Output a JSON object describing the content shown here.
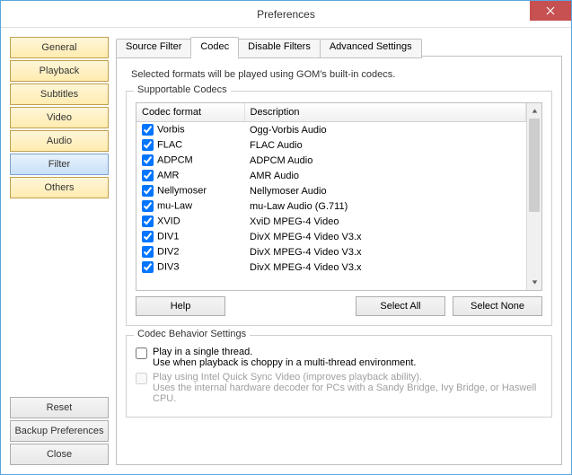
{
  "window": {
    "title": "Preferences"
  },
  "sidebar": {
    "items": [
      {
        "label": "General"
      },
      {
        "label": "Playback"
      },
      {
        "label": "Subtitles"
      },
      {
        "label": "Video"
      },
      {
        "label": "Audio"
      },
      {
        "label": "Filter"
      },
      {
        "label": "Others"
      }
    ],
    "selected_index": 5,
    "actions": {
      "reset": "Reset",
      "backup": "Backup Preferences",
      "close": "Close"
    }
  },
  "tabs": {
    "items": [
      {
        "label": "Source Filter"
      },
      {
        "label": "Codec"
      },
      {
        "label": "Disable Filters"
      },
      {
        "label": "Advanced Settings"
      }
    ],
    "active_index": 1
  },
  "description": "Selected formats will be played using GOM's built-in codecs.",
  "codecs": {
    "group_title": "Supportable Codecs",
    "columns": {
      "format": "Codec format",
      "description": "Description"
    },
    "rows": [
      {
        "checked": true,
        "format": "Vorbis",
        "description": "Ogg-Vorbis Audio"
      },
      {
        "checked": true,
        "format": "FLAC",
        "description": "FLAC Audio"
      },
      {
        "checked": true,
        "format": "ADPCM",
        "description": "ADPCM Audio"
      },
      {
        "checked": true,
        "format": "AMR",
        "description": "AMR Audio"
      },
      {
        "checked": true,
        "format": "Nellymoser",
        "description": "Nellymoser Audio"
      },
      {
        "checked": true,
        "format": "mu-Law",
        "description": "mu-Law Audio (G.711)"
      },
      {
        "checked": true,
        "format": "XVID",
        "description": "XviD MPEG-4 Video"
      },
      {
        "checked": true,
        "format": "DIV1",
        "description": "DivX MPEG-4 Video V3.x"
      },
      {
        "checked": true,
        "format": "DIV2",
        "description": "DivX MPEG-4 Video V3.x"
      },
      {
        "checked": true,
        "format": "DIV3",
        "description": "DivX MPEG-4 Video V3.x"
      }
    ],
    "buttons": {
      "help": "Help",
      "select_all": "Select All",
      "select_none": "Select None"
    }
  },
  "behavior": {
    "group_title": "Codec Behavior Settings",
    "option1": {
      "checked": false,
      "line1": "Play in a single thread.",
      "line2": "Use when playback is choppy in a multi-thread environment."
    },
    "option2": {
      "disabled": true,
      "line1": "Play using Intel Quick Sync Video (improves playback ability).",
      "line2": "Uses the internal hardware decoder for PCs with a Sandy Bridge, Ivy Bridge, or Haswell CPU."
    }
  }
}
